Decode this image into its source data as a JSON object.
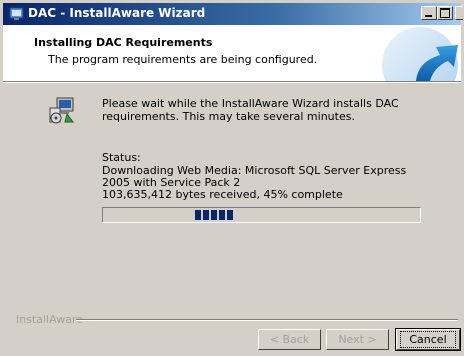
{
  "window": {
    "title": "DAC - InstallAware Wizard"
  },
  "header": {
    "title": "Installing DAC Requirements",
    "subtitle": "The program requirements are being configured."
  },
  "body": {
    "message": "Please wait while the InstallAware Wizard installs DAC requirements. This may take several minutes.",
    "status_label": "Status:",
    "status_detail": "Downloading Web Media: Microsoft SQL Server Express 2005 with Service Pack 2",
    "status_bytes": "103,635,412 bytes received, 45% complete",
    "progress_percent": 45
  },
  "footer": {
    "brand": "InstallAware",
    "back_label": "< Back",
    "next_label": "Next >",
    "cancel_label": "Cancel"
  },
  "colors": {
    "titlebar_start": "#0a246a",
    "titlebar_end": "#a6caf0",
    "dialog_face": "#d4d0c8",
    "progress_fill": "#0a246a"
  },
  "icons": {
    "title": "installer-icon",
    "wizard": "computer-setup-icon",
    "header": "blue-swoosh-graphic"
  }
}
